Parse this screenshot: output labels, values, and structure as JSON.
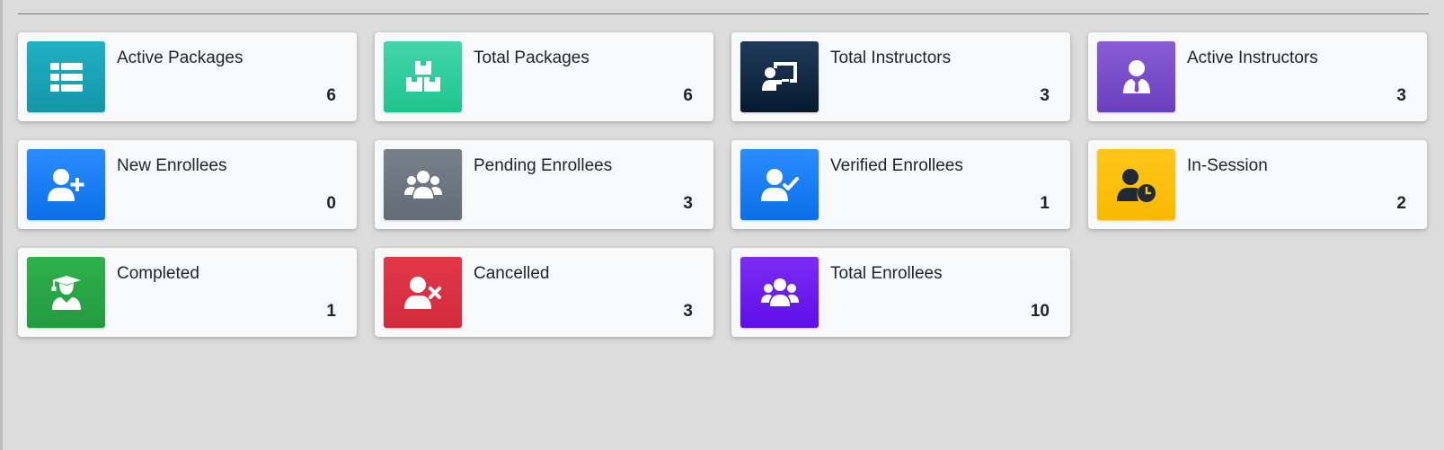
{
  "cards": [
    {
      "label": "Active Packages",
      "value": "6",
      "icon": "list-icon",
      "color": "#17a2b8"
    },
    {
      "label": "Total Packages",
      "value": "6",
      "icon": "boxes-icon",
      "color": "#20c997"
    },
    {
      "label": "Total Instructors",
      "value": "3",
      "icon": "chalkboard-teacher-icon",
      "color": "#0f2a44"
    },
    {
      "label": "Active Instructors",
      "value": "3",
      "icon": "user-tie-icon",
      "color": "#6f42c1"
    },
    {
      "label": "New Enrollees",
      "value": "0",
      "icon": "user-plus-icon",
      "color": "#007bff"
    },
    {
      "label": "Pending Enrollees",
      "value": "3",
      "icon": "users-icon",
      "color": "#6c757d"
    },
    {
      "label": "Verified Enrollees",
      "value": "1",
      "icon": "user-check-icon",
      "color": "#007bff"
    },
    {
      "label": "In-Session",
      "value": "2",
      "icon": "user-clock-icon",
      "color": "#ffc107"
    },
    {
      "label": "Completed",
      "value": "1",
      "icon": "user-graduate-icon",
      "color": "#28a745"
    },
    {
      "label": "Cancelled",
      "value": "3",
      "icon": "user-times-icon",
      "color": "#dc3545"
    },
    {
      "label": "Total Enrollees",
      "value": "10",
      "icon": "users-icon",
      "color": "#6610f2"
    }
  ],
  "colors": {
    "divider": "#17a2b8",
    "background": "#dcdcdc",
    "card": "#f8f9fa"
  }
}
